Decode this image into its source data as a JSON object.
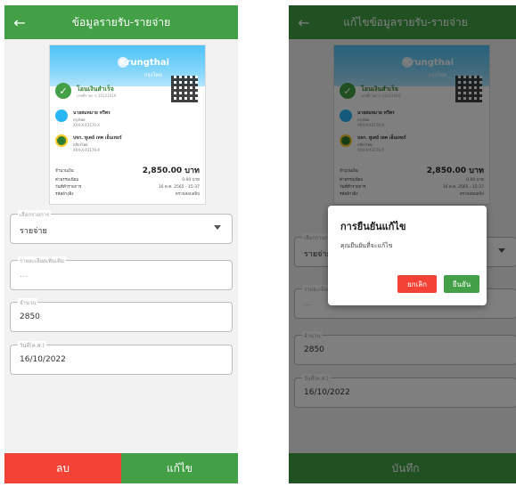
{
  "colors": {
    "green": "#43a047",
    "red": "#f44336"
  },
  "screen1": {
    "title": "ข้อมูลรายรับ-รายจ่าย",
    "slip": {
      "bank": "Krungthai",
      "bank_sub": "กรุงไทย",
      "status": "โอนเงินสำเร็จ",
      "status_date": "เลขที่รายการ 20221016",
      "sender": {
        "name": "นายสมหมาย ทวีพร",
        "bank": "กรุงไทย",
        "acct": "XXX-X-X3176-X"
      },
      "receiver": {
        "name": "บจก. ทูเดย์ เทค เอ็นเทอร์",
        "bank": "กสิกรไทย",
        "acct": "XXX-X-X3176-X"
      },
      "rows": [
        {
          "k": "จำนวนเงิน",
          "v": "2,850.00 บาท"
        },
        {
          "k": "ค่าธรรมเนียม",
          "v": "0.00 บาท"
        },
        {
          "k": "วันที่ทำรายการ",
          "v": "16 ต.ค. 2565 - 15:37"
        },
        {
          "k": "รหัสอ้างอิง",
          "v": "ตรวจสอบสลิป"
        }
      ]
    },
    "fields": [
      {
        "label": "เลือกรายการ",
        "value": "รายจ่าย"
      },
      {
        "label": "รายละเอียดเพิ่มเติม",
        "value": "..."
      },
      {
        "label": "จำนวน",
        "value": "2850"
      },
      {
        "label": "วันที่(ค.ศ.)",
        "value": "16/10/2022"
      }
    ],
    "delete_label": "ลบ",
    "edit_label": "แก้ไข"
  },
  "screen2": {
    "title": "แก้ไขข้อมูลรายรับ-รายจ่าย",
    "fields": [
      {
        "label": "เลือกรายการ",
        "value": "รายจ่าย"
      },
      {
        "label": "รายละเอียด",
        "value": "..."
      },
      {
        "label": "จำนวน",
        "value": "2850"
      },
      {
        "label": "วันที่(ค.ศ.)",
        "value": "16/10/2022"
      }
    ],
    "save_label": "บันทึก",
    "dialog": {
      "title": "การยืนยันแก้ไข",
      "message": "คุณยืนยันที่จะแก้ไข",
      "cancel_label": "ยกเลิก",
      "confirm_label": "ยืนยัน"
    }
  }
}
